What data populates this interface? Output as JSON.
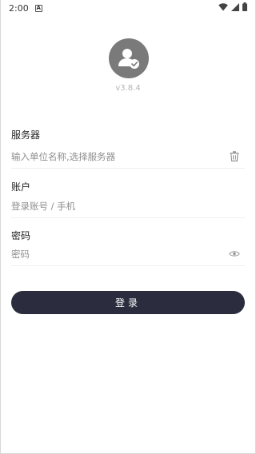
{
  "status_bar": {
    "time": "2:00",
    "notification_letter": "A"
  },
  "header": {
    "version": "v3.8.4"
  },
  "form": {
    "server": {
      "label": "服务器",
      "placeholder": "输入单位名称,选择服务器",
      "value": ""
    },
    "account": {
      "label": "账户",
      "placeholder": "登录账号 / 手机",
      "value": ""
    },
    "password": {
      "label": "密码",
      "placeholder": "密码",
      "value": ""
    }
  },
  "login_button": {
    "label": "登录"
  },
  "colors": {
    "button_bg": "#2b2d3e",
    "avatar_bg": "#7a7a7a",
    "placeholder": "#8f8f8f",
    "version": "#b5b5b5"
  }
}
